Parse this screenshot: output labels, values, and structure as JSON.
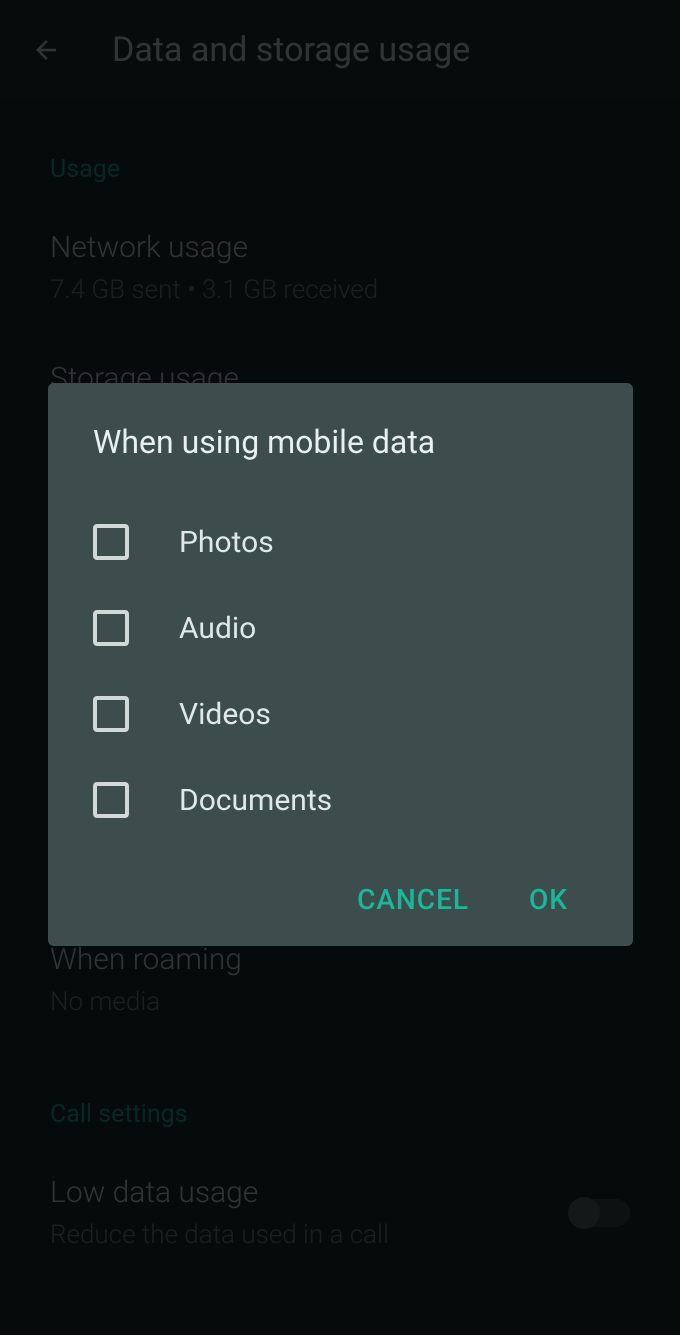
{
  "header": {
    "title": "Data and storage usage"
  },
  "sections": {
    "usage": {
      "header": "Usage",
      "network": {
        "title": "Network usage",
        "subtitle": "7.4 GB sent • 3.1 GB received"
      },
      "storage": {
        "title": "Storage usage"
      }
    },
    "roaming": {
      "title": "When roaming",
      "subtitle": "No media"
    },
    "callSettings": {
      "header": "Call settings",
      "lowData": {
        "title": "Low data usage",
        "subtitle": "Reduce the data used in a call"
      }
    }
  },
  "dialog": {
    "title": "When using mobile data",
    "options": {
      "photos": "Photos",
      "audio": "Audio",
      "videos": "Videos",
      "documents": "Documents"
    },
    "actions": {
      "cancel": "CANCEL",
      "ok": "OK"
    }
  }
}
